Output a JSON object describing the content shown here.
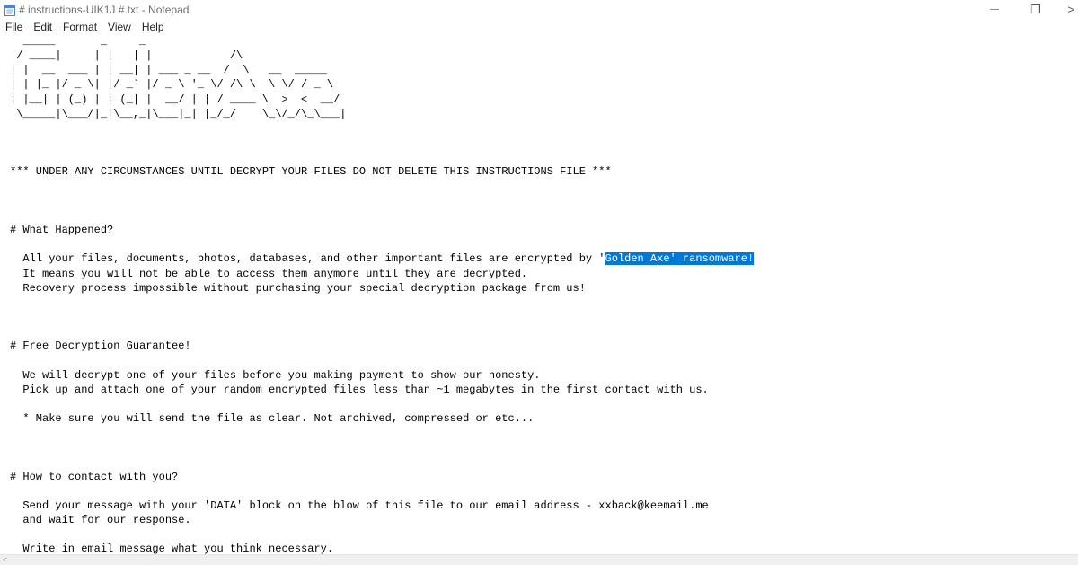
{
  "window": {
    "title": "# instructions-UIK1J #.txt - Notepad",
    "minimize_glyph": "—",
    "restore_glyph": "❐",
    "overflow_glyph": ">"
  },
  "menu": {
    "file": "File",
    "edit": "Edit",
    "format": "Format",
    "view": "View",
    "help": "Help"
  },
  "document": {
    "banner": [
      "  _____       _     _              ",
      " / ____|     | |   | |            /\\",
      "| |  __  ___ | | __| | ___ _ __  /  \\   __  _____",
      "| | |_ |/ _ \\| |/ _` |/ _ \\ '_ \\/ /\\ \\  \\ \\/ / _ \\",
      "| |__| | (_) | | (_| |  __/ | | / ____ \\  >  <  __/",
      " \\_____|\\___/|_|\\__,_|\\___|_| |_/_/    \\_\\/_/\\_\\___|"
    ],
    "warning": "*** UNDER ANY CIRCUMSTANCES UNTIL DECRYPT YOUR FILES DO NOT DELETE THIS INSTRUCTIONS FILE ***",
    "section1_heading": "# What Happened?",
    "section1_line1_prefix": "  All your files, documents, photos, databases, and other important files are encrypted by '",
    "section1_line1_selected": "Golden Axe' ransomware!",
    "section1_line2": "  It means you will not be able to access them anymore until they are decrypted.",
    "section1_line3": "  Recovery process impossible without purchasing your special decryption package from us!",
    "section2_heading": "# Free Decryption Guarantee!",
    "section2_line1": "  We will decrypt one of your files before you making payment to show our honesty.",
    "section2_line2": "  Pick up and attach one of your random encrypted files less than ~1 megabytes in the first contact with us.",
    "section2_note": "  * Make sure you will send the file as clear. Not archived, compressed or etc...",
    "section3_heading": "# How to contact with you?",
    "section3_line1": "  Send your message with your 'DATA' block on the blow of this file to our email address - xxback@keemail.me",
    "section3_line2": "  and wait for our response.",
    "section3_line3": "  Write in email message what you think necessary."
  },
  "scrollbar": {
    "left_arrow": "<"
  }
}
